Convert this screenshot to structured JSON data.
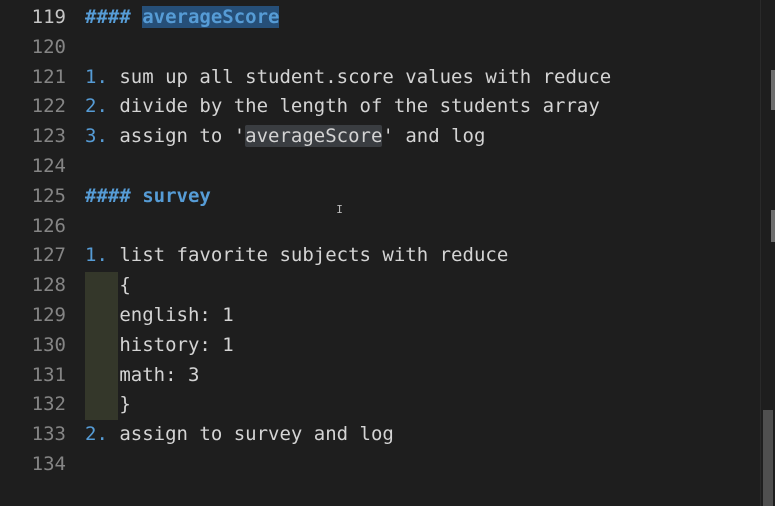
{
  "editor": {
    "lines": [
      {
        "num": "119",
        "parts": [
          {
            "t": "#### ",
            "c": "hdr"
          },
          {
            "t": "averageScore",
            "c": "sel-word"
          }
        ]
      },
      {
        "num": "120",
        "parts": []
      },
      {
        "num": "121",
        "parts": [
          {
            "t": "1.",
            "c": "num"
          },
          {
            "t": " sum up all student.score values with reduce",
            "c": ""
          }
        ]
      },
      {
        "num": "122",
        "parts": [
          {
            "t": "2.",
            "c": "num"
          },
          {
            "t": " divide by the length of the students array",
            "c": ""
          }
        ]
      },
      {
        "num": "123",
        "parts": [
          {
            "t": "3.",
            "c": "num"
          },
          {
            "t": " assign to '",
            "c": ""
          },
          {
            "t": "averageScore",
            "c": "match-word"
          },
          {
            "t": "' and log",
            "c": ""
          }
        ]
      },
      {
        "num": "124",
        "parts": []
      },
      {
        "num": "125",
        "parts": [
          {
            "t": "#### survey",
            "c": "hdr"
          }
        ]
      },
      {
        "num": "126",
        "parts": []
      },
      {
        "num": "127",
        "parts": [
          {
            "t": "1.",
            "c": "num"
          },
          {
            "t": " list favorite subjects with reduce",
            "c": ""
          }
        ]
      },
      {
        "num": "128",
        "parts": [
          {
            "t": "   {",
            "c": ""
          }
        ]
      },
      {
        "num": "129",
        "parts": [
          {
            "t": "   english: 1",
            "c": ""
          }
        ]
      },
      {
        "num": "130",
        "parts": [
          {
            "t": "   history: 1",
            "c": ""
          }
        ]
      },
      {
        "num": "131",
        "parts": [
          {
            "t": "   math: 3",
            "c": ""
          }
        ]
      },
      {
        "num": "132",
        "parts": [
          {
            "t": "   }",
            "c": ""
          }
        ]
      },
      {
        "num": "133",
        "parts": [
          {
            "t": "2.",
            "c": "num"
          },
          {
            "t": " assign to survey and log",
            "c": ""
          }
        ]
      },
      {
        "num": "134",
        "parts": []
      }
    ],
    "cursor_icon": "text-cursor-icon"
  }
}
